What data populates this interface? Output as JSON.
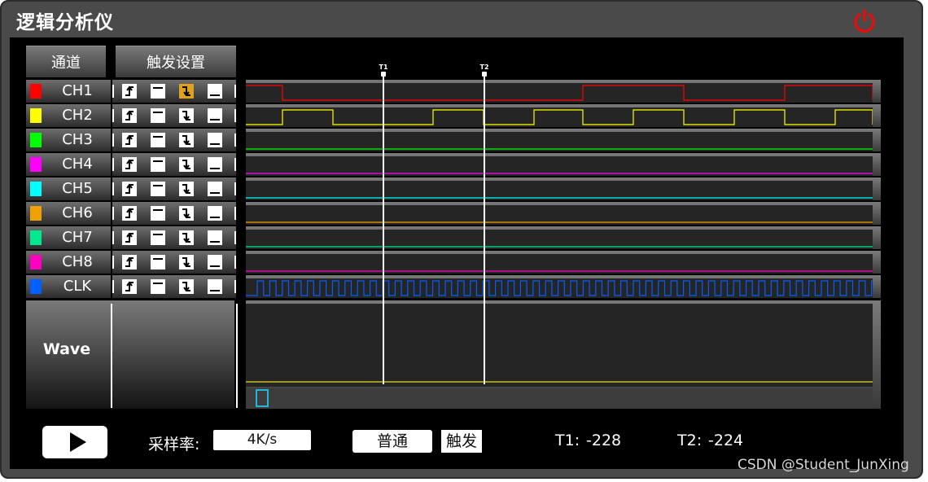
{
  "app": {
    "title": "逻辑分析仪"
  },
  "toolbar": {
    "channels_label": "通道",
    "trigger_settings_label": "触发设置"
  },
  "channels": [
    {
      "name": "CH1",
      "color": "#ff0000",
      "active_trigger": "falling",
      "wave": "H 0 L 45 H 414 L 538 H 662 L 770"
    },
    {
      "name": "CH2",
      "color": "#ffff00",
      "active_trigger": null,
      "wave": "L 0 H 45 L 107 H 230 L 292 H 354 L 414 H 476 L 538 H 600 L 662 H 724 L 770"
    },
    {
      "name": "CH3",
      "color": "#00ff00",
      "active_trigger": null,
      "wave": "L 0"
    },
    {
      "name": "CH4",
      "color": "#ff00ff",
      "active_trigger": null,
      "wave": "L 0"
    },
    {
      "name": "CH5",
      "color": "#00ffff",
      "active_trigger": null,
      "wave": "L 0"
    },
    {
      "name": "CH6",
      "color": "#f0a000",
      "active_trigger": null,
      "wave": "L 0"
    },
    {
      "name": "CH7",
      "color": "#00e890",
      "active_trigger": null,
      "wave": "L 0"
    },
    {
      "name": "CH8",
      "color": "#ff00c0",
      "active_trigger": null,
      "wave": "L 0"
    },
    {
      "name": "CLK",
      "color": "#0060ff",
      "active_trigger": null,
      "wave": "clock"
    }
  ],
  "trigger_icons": [
    "rising-edge-icon",
    "high-level-icon",
    "falling-edge-icon",
    "low-level-icon"
  ],
  "wave_panel": {
    "label": "Wave",
    "trace_color": "#c8c020"
  },
  "cursors": [
    {
      "label": "T1",
      "value": "-228"
    },
    {
      "label": "T2",
      "value": "-224"
    }
  ],
  "controls": {
    "sample_rate_label": "采样率:",
    "sample_rate_value": "4K/s",
    "mode_normal_label": "普通",
    "mode_trigger_label": "触发",
    "t1_label": "T1:",
    "t2_label": "T2:"
  },
  "colors": {
    "accent_power": "#e01010",
    "scroll_thumb": "#22b7d6"
  },
  "watermark": "CSDN @Student_JunXing"
}
